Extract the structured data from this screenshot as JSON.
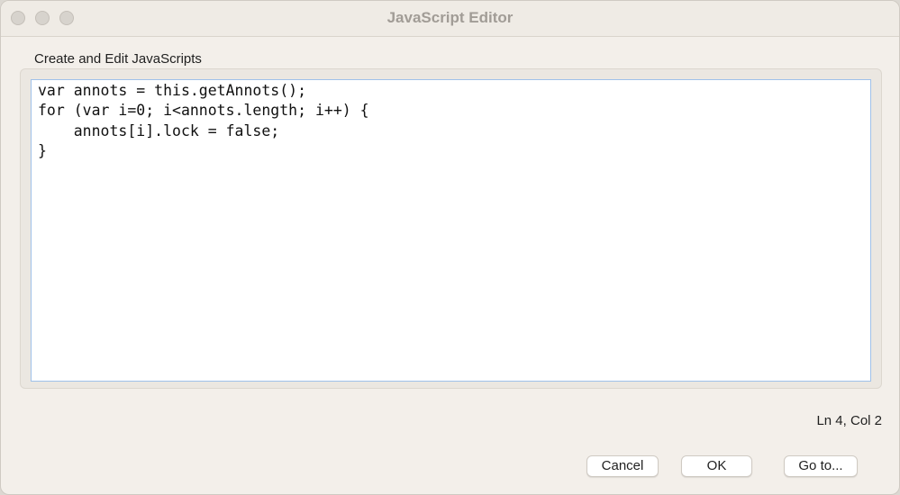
{
  "window": {
    "title": "JavaScript Editor"
  },
  "editor": {
    "section_label": "Create and Edit JavaScripts",
    "lines": [
      "var annots = this.getAnnots();",
      "for (var i=0; i<annots.length; i++) {",
      "    annots[i].lock = false;",
      "}"
    ]
  },
  "status": {
    "cursor_position": "Ln 4, Col 2"
  },
  "buttons": {
    "cancel": "Cancel",
    "ok": "OK",
    "goto": "Go to..."
  },
  "colors": {
    "window_bg": "#f3efea",
    "editor_focus_border": "#9fc1ea",
    "title_text": "#a19c96"
  }
}
